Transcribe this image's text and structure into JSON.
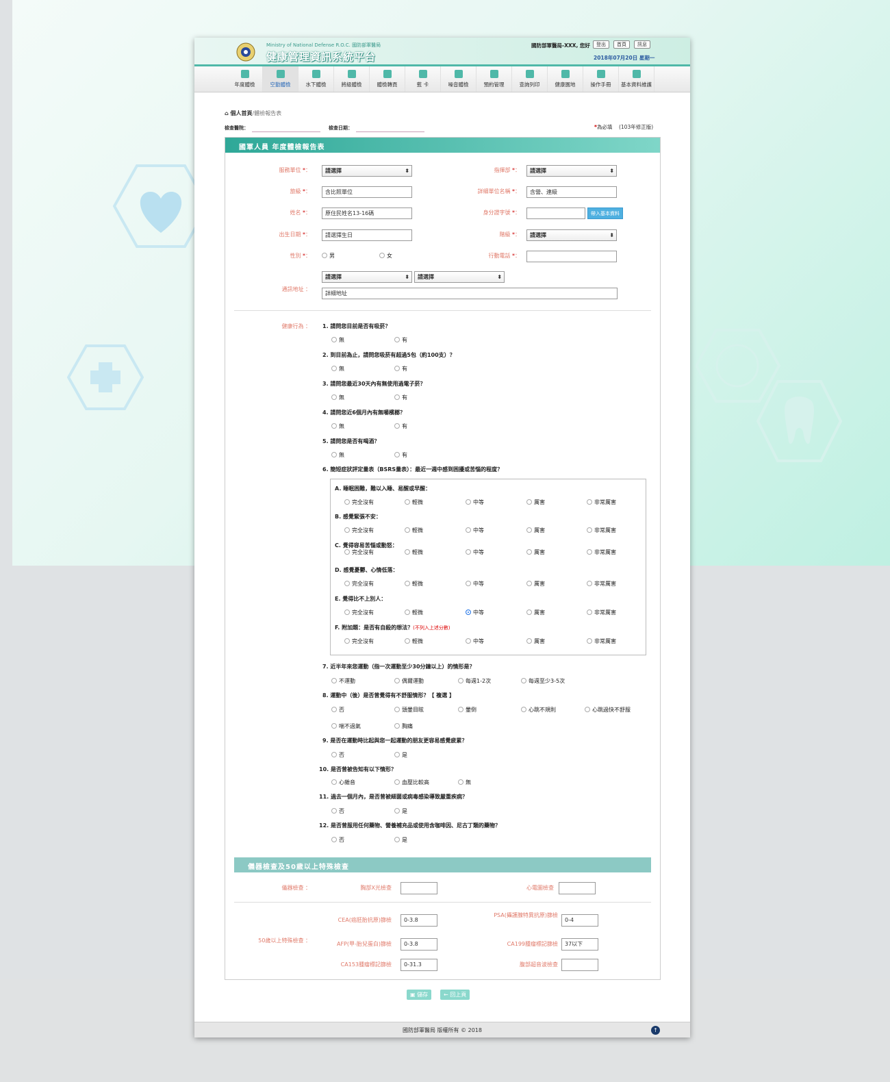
{
  "header": {
    "org_en": "Ministry of National Defense R.O.C. 國防部軍醫局",
    "title": "健康管理資訊系統平台",
    "greeting": "國防部軍醫局-XXX, 您好",
    "logout": "登出",
    "home": "首頁",
    "news": "訊息",
    "date": "2018年07月20日 星期一"
  },
  "nav": {
    "items": [
      "年度體檢",
      "空勤體檢",
      "水下體檢",
      "將級體檢",
      "體檢轉頁",
      "藍 卡",
      "噪音體檢",
      "預約管理",
      "查詢列印",
      "健康園地",
      "操作手冊",
      "基本資料維護"
    ],
    "active_index": 1
  },
  "breadcrumb": {
    "home": "個人首頁",
    "sep": "/",
    "current": "體檢報告表"
  },
  "meta": {
    "hospital_label": "檢查醫院：",
    "date_label": "檢查日期：",
    "required_mark": "*",
    "required_text": "為必填",
    "version": "(103年修正版)"
  },
  "form": {
    "title": "國軍人員 年度體檢報告表",
    "unit_label": "服務單位",
    "unit_value": "請選擇",
    "command_label": "指揮部",
    "command_value": "請選擇",
    "brigade_label": "旅級",
    "brigade_value": "含比照單位",
    "detail_unit_label": "詳細單位名稱",
    "detail_unit_value": "含營、連級",
    "name_label": "姓名",
    "name_value": "原住民姓名13-16碼",
    "id_label": "身分證字號",
    "import_btn": "帶入基本資料",
    "birth_label": "出生日期",
    "birth_value": "請選擇生日",
    "rank_label": "階級",
    "rank_value": "請選擇",
    "gender_label": "性別",
    "male": "男",
    "female": "女",
    "phone_label": "行動電話",
    "address_label": "通訊地址",
    "city": "請選擇",
    "district": "請選擇",
    "address_placeholder": "詳細地址",
    "colon": "：",
    "star": "*"
  },
  "health": {
    "label": "健康行為",
    "q1": "1.  請問您目前是否有吸菸？",
    "q2": "2.  到目前為止，請問您吸菸有超過5包（約100支）？",
    "q3": "3.  請問您最近30天內有無使用過電子菸？",
    "q4": "4.  請問您近6個月內有無嚼檳榔？",
    "q5": "5.  請問您是否有喝酒？",
    "no": "無",
    "yes": "有",
    "q6": "6.  簡短症狀評定量表（BSRS量表）：最近一週中感到困擾或苦惱的程度？",
    "bsrs_items": [
      "A.  睡眠困難，難以入睡、易醒或早醒：",
      "B.  感覺緊張不安：",
      "C.  覺得容易苦惱或動怒：",
      "D.  感覺憂鬱、心情低落：",
      "E.  覺得比不上別人：",
      "F.  附加題：是否有自殺的想法？"
    ],
    "bsrs_note": "(不列入上述分數)",
    "bsrs_opts": [
      "完全沒有",
      "輕微",
      "中等",
      "厲害",
      "非常厲害"
    ],
    "bsrs_selected": {
      "E": 2
    },
    "q7": "7.  近半年來您運動（指一次運動至少30分鐘以上）的情形是？",
    "q7_opts": [
      "不運動",
      "偶爾運動",
      "每週1-2次",
      "每週至少3-5次"
    ],
    "q8": "8.  運動中（後）是否曾覺得有不舒服情形？【 複選 】",
    "q8_opts": [
      "否",
      "頭暈目眩",
      "暈倒",
      "心跳不規則",
      "心跳過快不舒服",
      "喘不過氣",
      "胸痛"
    ],
    "q9": "9.  是否在運動時比起與您一起運動的朋友更容易感覺疲累？",
    "q10": "10.  是否曾被告知有以下情形？",
    "q10_opts": [
      "心雜音",
      "血壓比較高",
      "無"
    ],
    "q11": "11.  過去一個月內，是否曾被細菌或病毒感染導致嚴重疾病？",
    "q12": "12.  是否曾服用任何藥物、營養補充品或使用含咖啡因、尼古丁類的藥物？",
    "neg": "否",
    "pos": "是"
  },
  "instrument": {
    "section_title": "儀器檢查及50歲以上特殊檢查",
    "label": "儀器檢查",
    "xray": "胸部X光檢查",
    "ecg": "心電圖檢查",
    "special_label": "50歲以上特殊檢查",
    "cea": "CEA(癌胚胎抗原)篩檢",
    "cea_ph": "0-3.8",
    "psa": "PSA(攝護腺特異抗原)篩檢",
    "psa_ph": "0-4",
    "afp": "AFP(甲-胎兒蛋白)篩檢",
    "afp_ph": "0-3.8",
    "ca199": "CA199腫瘤標記篩檢",
    "ca199_ph": "37以下",
    "ca153": "CA153腫瘤標記篩檢",
    "ca153_ph": "0-31.3",
    "abd": "腹部超音波檢查"
  },
  "actions": {
    "save": "儲存",
    "back": "回上頁"
  },
  "footer": {
    "copyright": "國防部軍醫局 版權所有 © 2018"
  },
  "colors": {
    "accent": "#4fb8a8",
    "label": "#e07a6a",
    "required": "#cc0000"
  }
}
